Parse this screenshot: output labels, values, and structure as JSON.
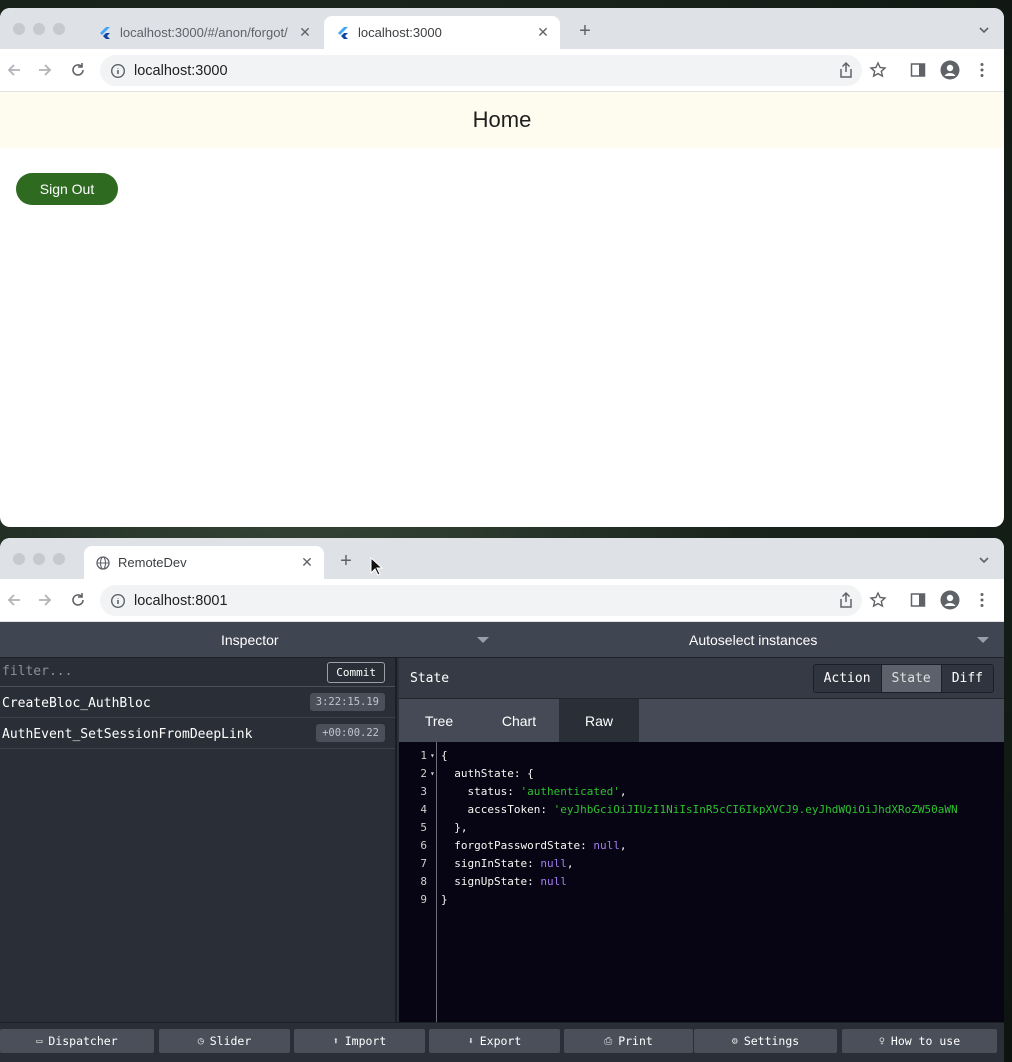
{
  "window1": {
    "tabs": [
      {
        "title": "localhost:3000/#/anon/forgot/",
        "active": false
      },
      {
        "title": "localhost:3000",
        "active": true
      }
    ],
    "url": "localhost:3000",
    "app": {
      "title": "Home",
      "sign_out_label": "Sign Out",
      "appbar_color": "#fdfcef",
      "button_color": "#2e6b21"
    }
  },
  "window2": {
    "tabs": [
      {
        "title": "RemoteDev",
        "active": true
      }
    ],
    "url": "localhost:8001",
    "devtools": {
      "inspector_label": "Inspector",
      "instances_label": "Autoselect instances",
      "filter_placeholder": "filter...",
      "commit_label": "Commit",
      "actions": [
        {
          "name": "CreateBloc_AuthBloc",
          "time": "3:22:15.19"
        },
        {
          "name": "AuthEvent_SetSessionFromDeepLink",
          "time": "+00:00.22"
        }
      ],
      "panel_title": "State",
      "mode_buttons": [
        "Action",
        "State",
        "Diff"
      ],
      "active_mode": "State",
      "view_tabs": [
        "Tree",
        "Chart",
        "Raw"
      ],
      "active_view": "Raw",
      "raw_lines": [
        {
          "n": "1",
          "fold": true,
          "text": "{"
        },
        {
          "n": "2",
          "fold": true,
          "text": "  authState: {"
        },
        {
          "n": "3",
          "fold": false,
          "key": "    status: ",
          "str": "'authenticated'",
          "tail": ","
        },
        {
          "n": "4",
          "fold": false,
          "key": "    accessToken: ",
          "str": "'eyJhbGciOiJIUzI1NiIsInR5cCI6IkpXVCJ9.eyJhdWQiOiJhdXRoZW50aWN",
          "tail": ""
        },
        {
          "n": "5",
          "fold": false,
          "text": "  },"
        },
        {
          "n": "6",
          "fold": false,
          "key": "  forgotPasswordState: ",
          "nul": "null",
          "tail": ","
        },
        {
          "n": "7",
          "fold": false,
          "key": "  signInState: ",
          "nul": "null",
          "tail": ","
        },
        {
          "n": "8",
          "fold": false,
          "key": "  signUpState: ",
          "nul": "null",
          "tail": ""
        },
        {
          "n": "9",
          "fold": false,
          "text": "}"
        }
      ],
      "footer_buttons": [
        {
          "label": "Dispatcher",
          "icon": "keyboard-icon",
          "glyph": "▭"
        },
        {
          "label": "Slider",
          "icon": "timer-icon",
          "glyph": "◷"
        },
        {
          "label": "Import",
          "icon": "upload-icon",
          "glyph": "⬆"
        },
        {
          "label": "Export",
          "icon": "download-icon",
          "glyph": "⬇"
        },
        {
          "label": "Print",
          "icon": "print-icon",
          "glyph": "⎙"
        },
        {
          "label": "Settings",
          "icon": "gear-icon",
          "glyph": "⚙"
        },
        {
          "label": "How to use",
          "icon": "lightbulb-icon",
          "glyph": "♀"
        }
      ]
    }
  }
}
